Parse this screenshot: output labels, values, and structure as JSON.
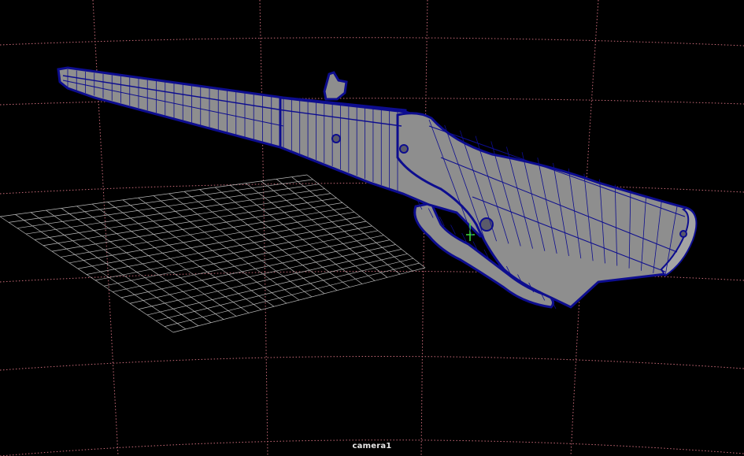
{
  "viewport": {
    "camera_label": "camera1",
    "background": "#000000",
    "colors": {
      "dome_grid": "#c86a78",
      "floor_grid": "#b9b9b9",
      "mesh_fill": "#8e8e8e",
      "mesh_fill_light": "#a4a4a4",
      "wireframe": "#0d0d8f",
      "pivot": "#3ddc3d"
    },
    "object": {
      "icon": "flintlock-rifle-wireframe-model",
      "display_mode": "shaded-with-wireframe"
    }
  }
}
